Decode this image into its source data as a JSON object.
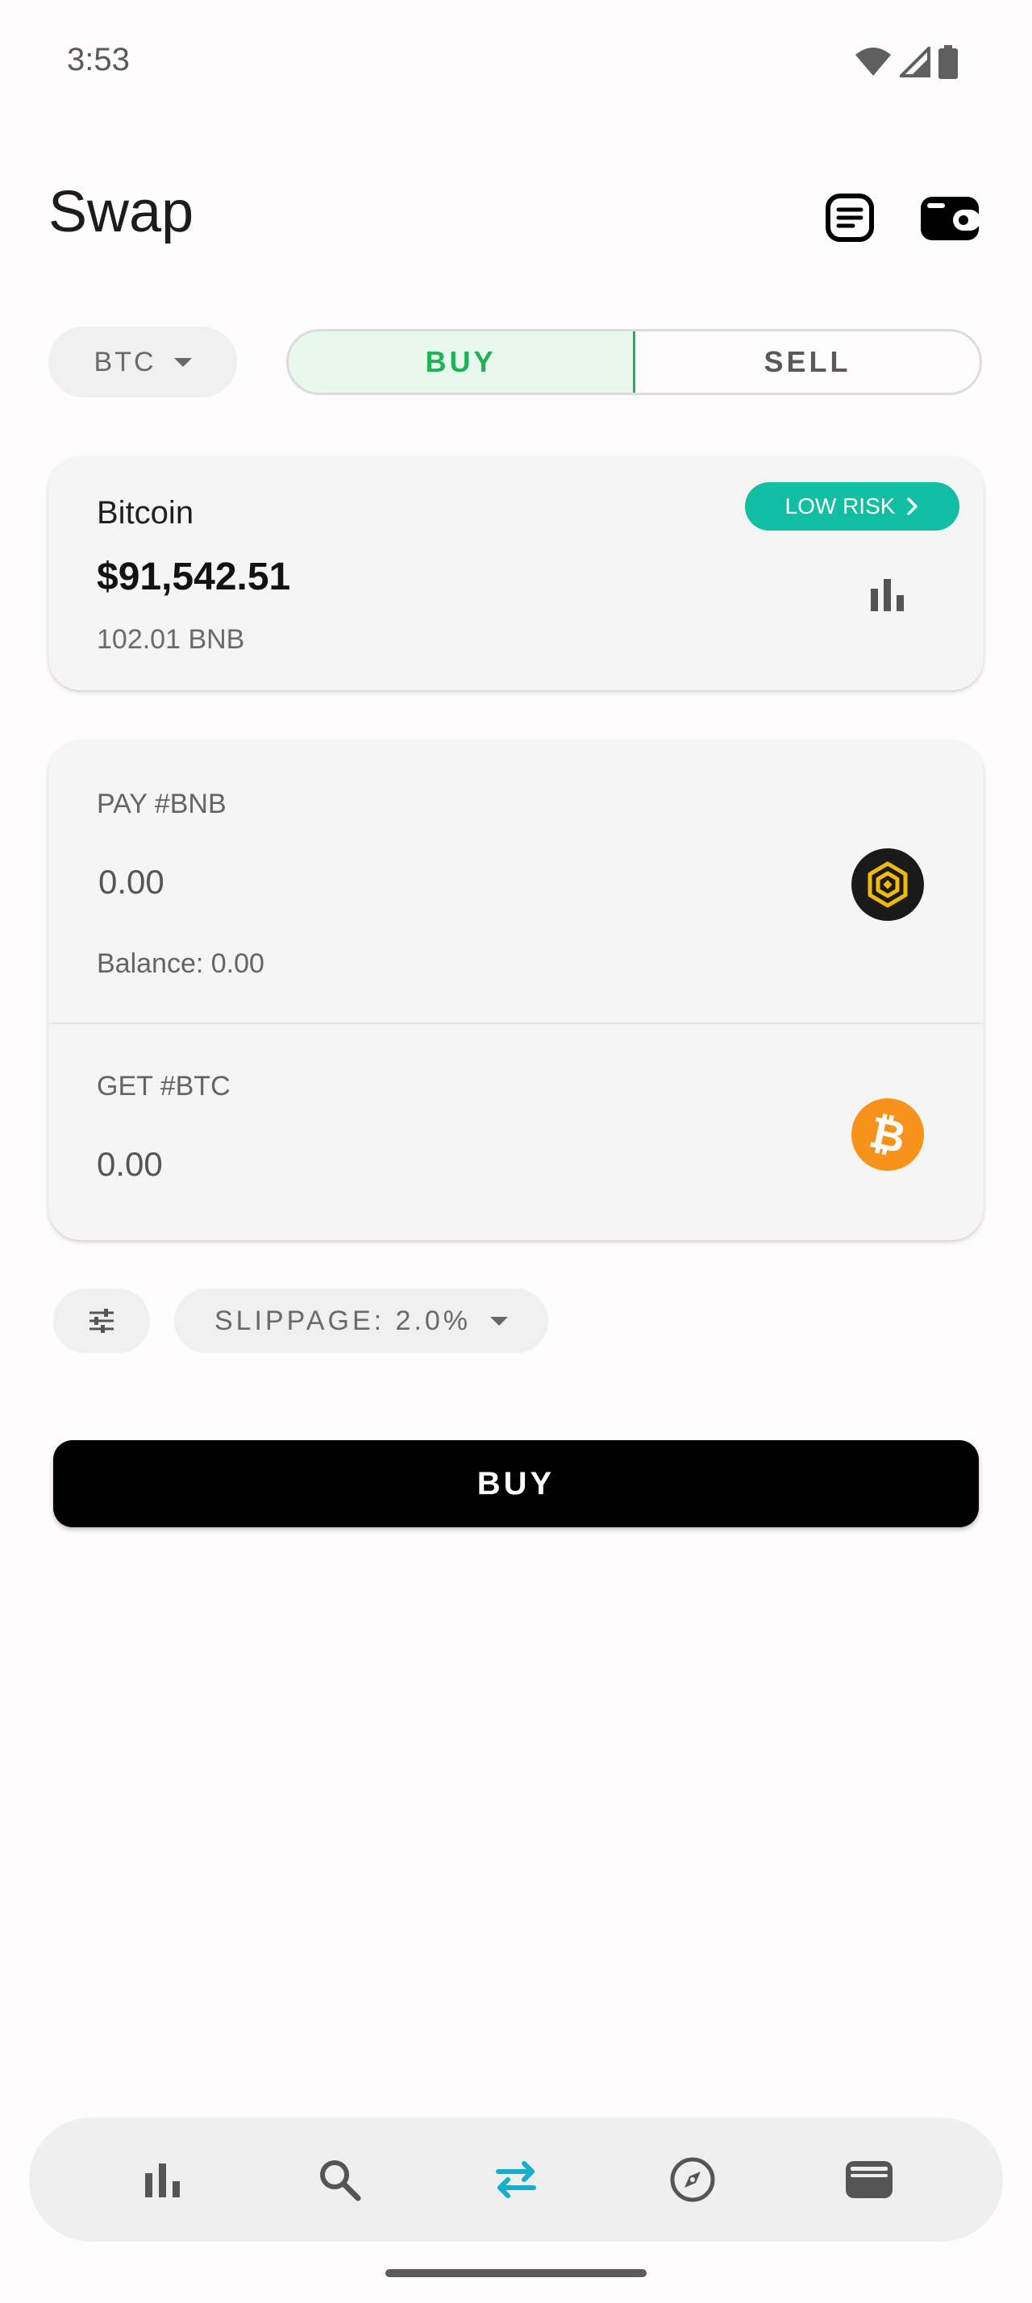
{
  "status_bar": {
    "time": "3:53",
    "icons": [
      "wifi-icon",
      "signal-icon",
      "battery-icon"
    ]
  },
  "header": {
    "title": "Swap",
    "actions": [
      "document-icon",
      "wallet-icon"
    ]
  },
  "asset_selector": {
    "value": "BTC"
  },
  "trade_toggle": {
    "buy_label": "BUY",
    "sell_label": "SELL",
    "selected": "BUY"
  },
  "coin_card": {
    "name": "Bitcoin",
    "price": "$91,542.51",
    "holding": "102.01 BNB",
    "risk_label": "LOW RISK"
  },
  "swap": {
    "pay_label": "PAY #BNB",
    "pay_amount": "0.00",
    "balance": "Balance: 0.00",
    "get_label": "GET #BTC",
    "get_amount": "0.00",
    "pay_token_icon": "bnb-icon",
    "get_token_icon": "bitcoin-icon"
  },
  "settings": {
    "slippage_label": "SLIPPAGE: 2.0%"
  },
  "primary_action": {
    "label": "BUY"
  },
  "bottom_nav": {
    "items": [
      "chart-icon",
      "search-icon",
      "swap-icon",
      "compass-icon",
      "wallet-icon"
    ],
    "active": "swap-icon"
  },
  "colors": {
    "accent_green": "#22b35a",
    "risk_teal": "#10bfa3",
    "nav_active": "#16aecd",
    "btc_orange": "#f7931a",
    "bnb_yellow": "#f0b90b"
  }
}
